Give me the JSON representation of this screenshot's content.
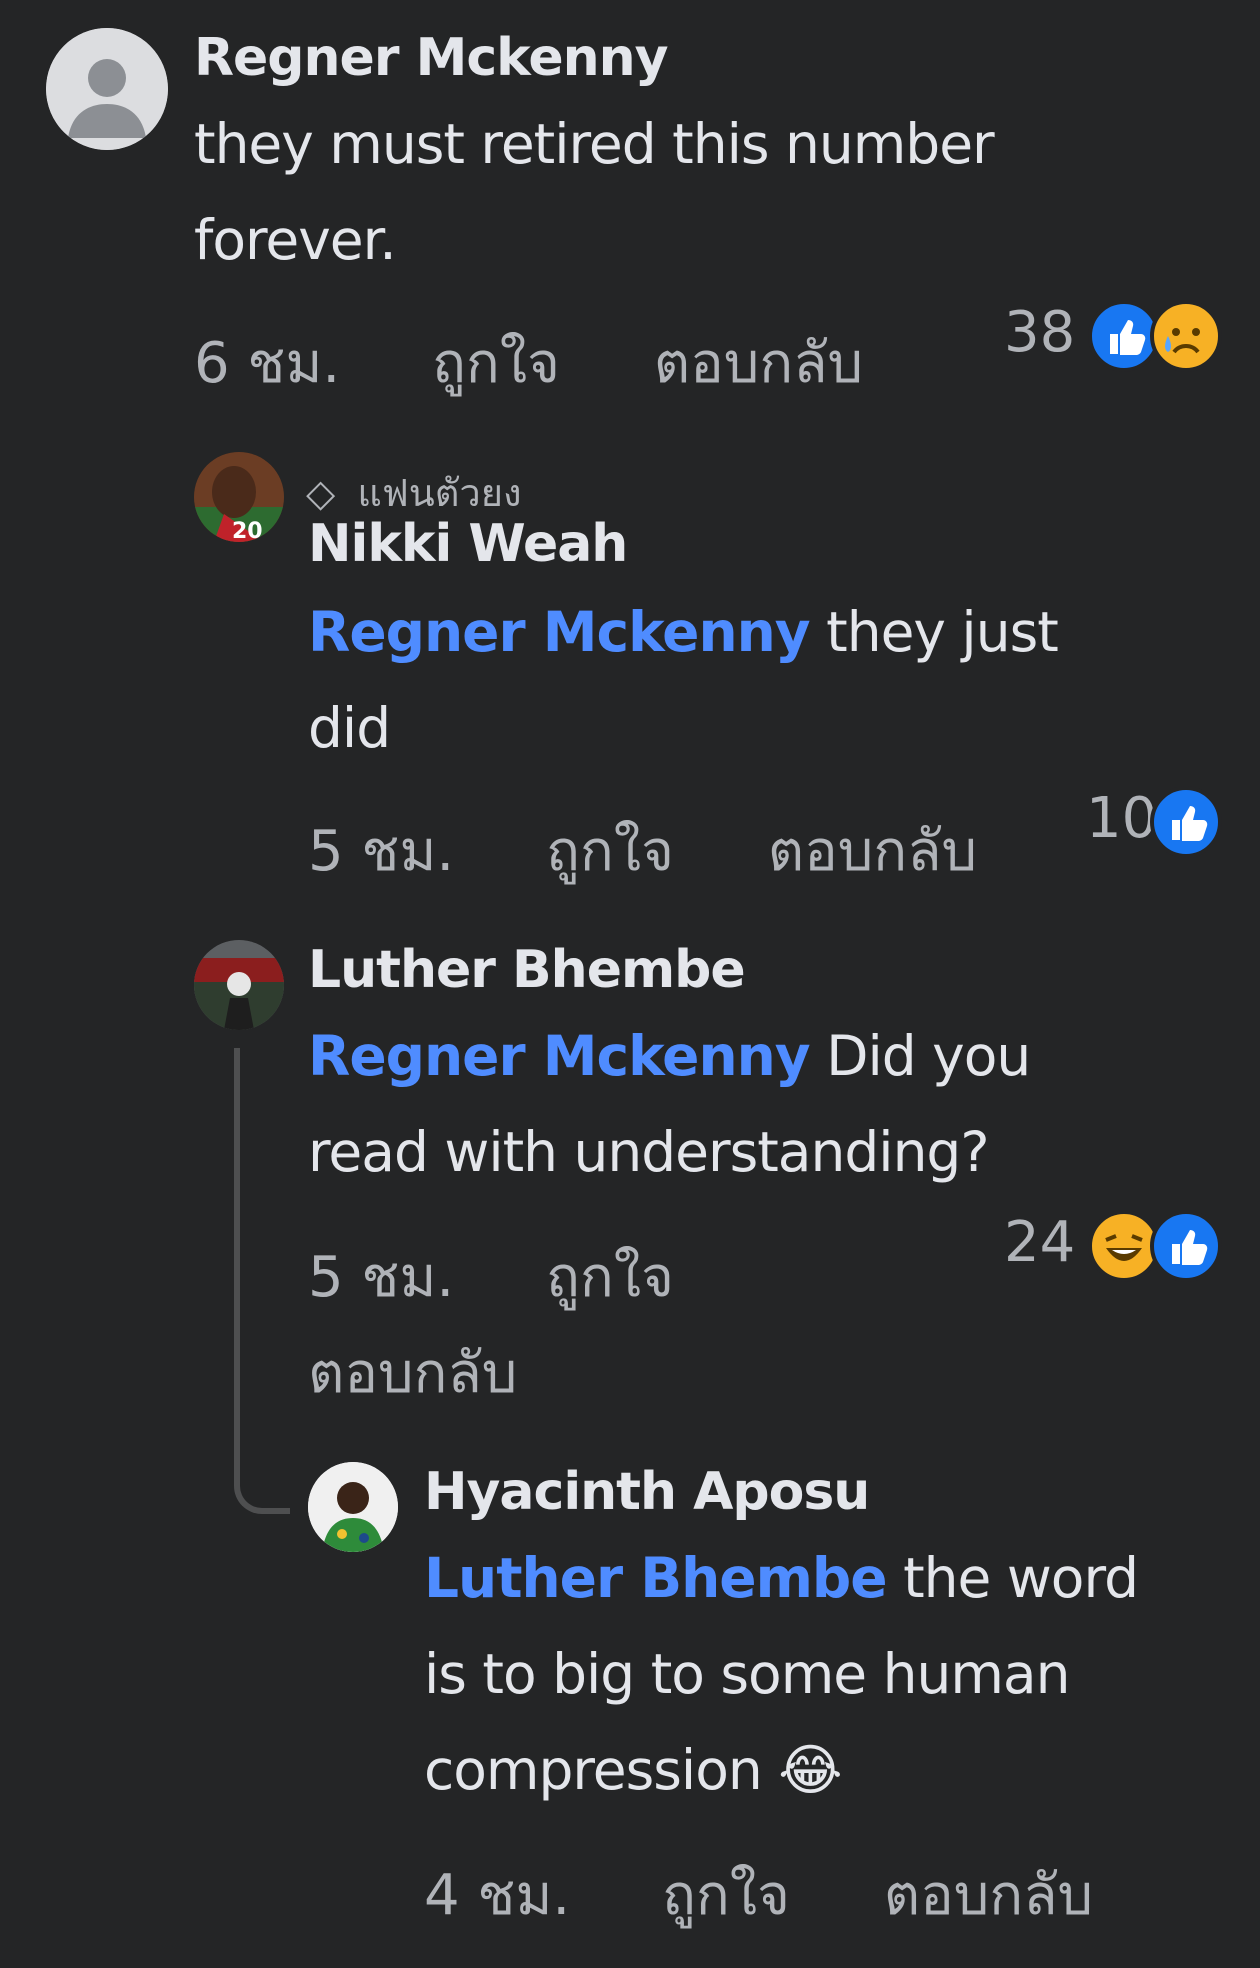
{
  "comments": [
    {
      "name": "Regner Mckenny",
      "text": "they must retired this number forever.",
      "time": "6 ชม.",
      "like": "ถูกใจ",
      "reply": "ตอบกลับ",
      "reaction_count": "38",
      "reactions": [
        "like-icon",
        "sad-face-icon"
      ]
    },
    {
      "badge": "แฟนตัวยง",
      "name": "Nikki Weah",
      "mention": "Regner Mckenny",
      "text": " they just did",
      "time": "5 ชม.",
      "like": "ถูกใจ",
      "reply": "ตอบกลับ",
      "reaction_count": "10",
      "reactions": [
        "like-icon"
      ]
    },
    {
      "name": "Luther Bhembe",
      "mention": "Regner Mckenny",
      "text": " Did you read with understanding?",
      "time": "5 ชม.",
      "like": "ถูกใจ",
      "reply": "ตอบกลับ",
      "reaction_count": "24",
      "reactions": [
        "laughing-face-icon",
        "like-icon"
      ]
    },
    {
      "name": "Hyacinth Aposu",
      "mention": "Luther Bhembe",
      "text": " the word is to big to some human compression",
      "emoji": "😂",
      "time": "4 ชม.",
      "like": "ถูกใจ",
      "reply": "ตอบกลับ"
    }
  ],
  "colors": {
    "background": "#242526",
    "text": "#e4e6eb",
    "secondary": "#b0b3b8",
    "mention": "#4f8cff",
    "like_blue": "#1877f2"
  }
}
